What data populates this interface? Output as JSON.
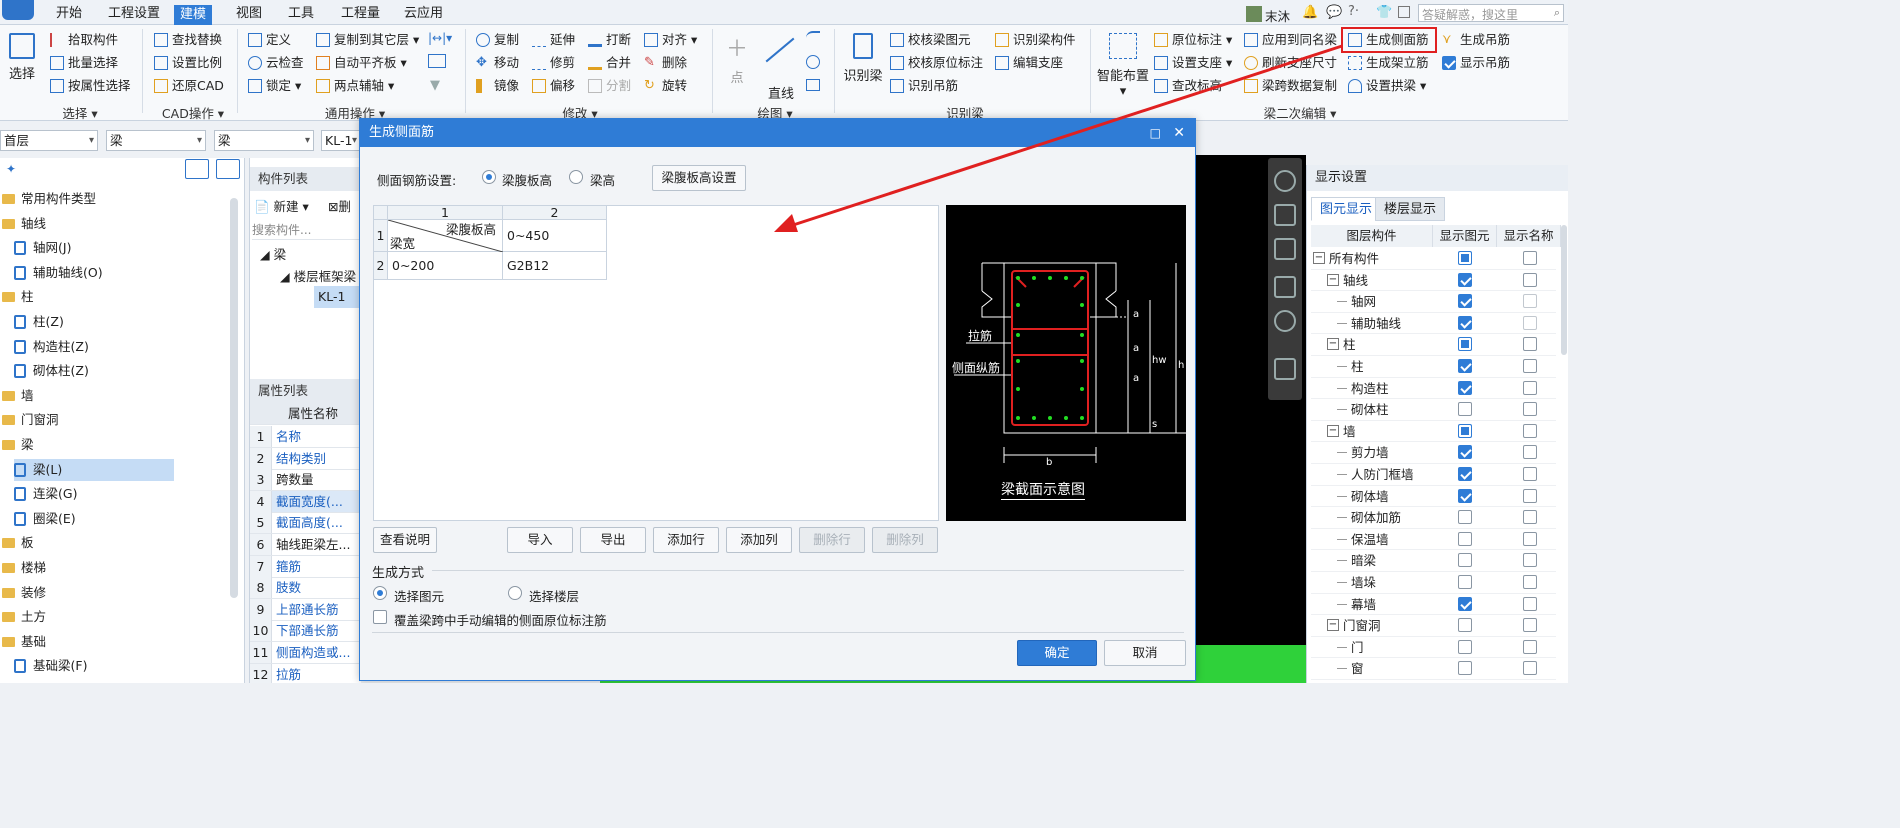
{
  "menubar": {
    "items": [
      "开始",
      "工程设置",
      "建模",
      "视图",
      "工具",
      "工程量",
      "云应用"
    ],
    "active": "建模",
    "user": "末沐",
    "search_placeholder": "答疑解惑，搜这里"
  },
  "ribbon": {
    "select_group": {
      "big": "选择",
      "items": [
        "拾取构件",
        "批量选择",
        "按属性选择"
      ],
      "label": "选择"
    },
    "cad_group": {
      "items": [
        "查找替换",
        "设置比例",
        "还原CAD"
      ],
      "label": "CAD操作"
    },
    "common_group": {
      "items": [
        "定义",
        "云检查",
        "锁定",
        "复制到其它层",
        "自动平齐板",
        "两点辅轴"
      ],
      "label": "通用操作"
    },
    "modify_group": {
      "items": [
        "复制",
        "移动",
        "镜像",
        "延伸",
        "修剪",
        "偏移",
        "打断",
        "合并",
        "分割",
        "对齐",
        "删除",
        "旋转"
      ],
      "label": "修改"
    },
    "draw_group": {
      "items": [
        "点",
        "直线"
      ],
      "label": "绘图"
    },
    "recognize_group": {
      "big": "识别梁",
      "items": [
        "校核梁图元",
        "校核原位标注",
        "识别吊筋",
        "识别梁构件",
        "编辑支座"
      ],
      "label": "识别梁"
    },
    "beam_edit_group": {
      "big": "智能布置",
      "items": [
        "原位标注",
        "设置支座",
        "查改标高",
        "应用到同名梁",
        "刷新支座尺寸",
        "梁跨数据复制",
        "生成侧面筋",
        "生成架立筋",
        "设置拱梁",
        "生成吊筋",
        "显示吊筋"
      ],
      "label": "梁二次编辑"
    }
  },
  "selectors": [
    "首层",
    "梁",
    "梁",
    "KL-1"
  ],
  "left_tree": {
    "items": [
      {
        "label": "常用构件类型",
        "type": "folder"
      },
      {
        "label": "轴线",
        "type": "folder"
      },
      {
        "label": "轴网(J)",
        "type": "leaf"
      },
      {
        "label": "辅助轴线(O)",
        "type": "leaf"
      },
      {
        "label": "柱",
        "type": "folder"
      },
      {
        "label": "柱(Z)",
        "type": "leaf"
      },
      {
        "label": "构造柱(Z)",
        "type": "leaf"
      },
      {
        "label": "砌体柱(Z)",
        "type": "leaf"
      },
      {
        "label": "墙",
        "type": "folder"
      },
      {
        "label": "门窗洞",
        "type": "folder"
      },
      {
        "label": "梁",
        "type": "folder"
      },
      {
        "label": "梁(L)",
        "type": "leaf",
        "selected": true
      },
      {
        "label": "连梁(G)",
        "type": "leaf"
      },
      {
        "label": "圈梁(E)",
        "type": "leaf"
      },
      {
        "label": "板",
        "type": "folder"
      },
      {
        "label": "楼梯",
        "type": "folder"
      },
      {
        "label": "装修",
        "type": "folder"
      },
      {
        "label": "土方",
        "type": "folder"
      },
      {
        "label": "基础",
        "type": "folder"
      },
      {
        "label": "基础梁(F)",
        "type": "leaf"
      }
    ]
  },
  "component_list": {
    "title": "构件列表",
    "new_button": "新建",
    "delete_button": "删",
    "search_placeholder": "搜索构件...",
    "tree": [
      "梁",
      "楼层框架梁",
      "KL-1"
    ]
  },
  "property_list": {
    "title": "属性列表",
    "col_header": "属性名称",
    "rows": [
      {
        "n": "1",
        "name": "名称",
        "blue": true
      },
      {
        "n": "2",
        "name": "结构类别",
        "blue": true
      },
      {
        "n": "3",
        "name": "跨数量",
        "blue": false
      },
      {
        "n": "4",
        "name": "截面宽度(...",
        "blue": true
      },
      {
        "n": "5",
        "name": "截面高度(...",
        "blue": true
      },
      {
        "n": "6",
        "name": "轴线距梁左...",
        "blue": false
      },
      {
        "n": "7",
        "name": "箍筋",
        "blue": true
      },
      {
        "n": "8",
        "name": "肢数",
        "blue": true
      },
      {
        "n": "9",
        "name": "上部通长筋",
        "blue": true
      },
      {
        "n": "10",
        "name": "下部通长筋",
        "blue": true
      },
      {
        "n": "11",
        "name": "侧面构造或...",
        "blue": true
      },
      {
        "n": "12",
        "name": "拉筋",
        "blue": true
      }
    ]
  },
  "dialog": {
    "title": "生成侧面筋",
    "setting_label": "侧面钢筋设置:",
    "radio_options": [
      "梁腹板高",
      "梁高"
    ],
    "radio_selected": "梁腹板高",
    "web_height_button": "梁腹板高设置",
    "table": {
      "col_headers": [
        "1",
        "2"
      ],
      "row_headers": [
        "1",
        "2"
      ],
      "corner_top": "梁腹板高",
      "corner_bottom": "梁宽",
      "r1c2": "0~450",
      "r2c1": "0~200",
      "r2c2": "G2B12"
    },
    "preview": {
      "caption": "梁截面示意图",
      "label_tie": "拉筋",
      "label_side": "侧面纵筋",
      "dim_a": "a",
      "dim_hw": "hw",
      "dim_h": "h",
      "dim_s": "s",
      "dim_b": "b"
    },
    "buttons": {
      "help": "查看说明",
      "import": "导入",
      "export": "导出",
      "add_row": "添加行",
      "add_col": "添加列",
      "del_row": "删除行",
      "del_col": "删除列"
    },
    "gen_mode_label": "生成方式",
    "gen_options": [
      "选择图元",
      "选择楼层"
    ],
    "gen_selected": "选择图元",
    "override_label": "覆盖梁跨中手动编辑的侧面原位标注筋",
    "override_checked": false,
    "ok": "确定",
    "cancel": "取消"
  },
  "display_settings": {
    "title": "显示设置",
    "tabs": [
      "图元显示",
      "楼层显示"
    ],
    "active_tab": "图元显示",
    "columns": [
      "图层构件",
      "显示图元",
      "显示名称"
    ],
    "rows": [
      {
        "label": "所有构件",
        "level": 0,
        "exp": "−",
        "show": "part",
        "name": false
      },
      {
        "label": "轴线",
        "level": 1,
        "exp": "−",
        "show": "on",
        "name": false
      },
      {
        "label": "轴网",
        "level": 2,
        "show": "on",
        "name": "dis"
      },
      {
        "label": "辅助轴线",
        "level": 2,
        "show": "on",
        "name": "dis"
      },
      {
        "label": "柱",
        "level": 1,
        "exp": "−",
        "show": "part",
        "name": false
      },
      {
        "label": "柱",
        "level": 2,
        "show": "on",
        "name": false
      },
      {
        "label": "构造柱",
        "level": 2,
        "show": "on",
        "name": false
      },
      {
        "label": "砌体柱",
        "level": 2,
        "show": false,
        "name": false
      },
      {
        "label": "墙",
        "level": 1,
        "exp": "−",
        "show": "part",
        "name": false
      },
      {
        "label": "剪力墙",
        "level": 2,
        "show": "on",
        "name": false
      },
      {
        "label": "人防门框墙",
        "level": 2,
        "show": "on",
        "name": false
      },
      {
        "label": "砌体墙",
        "level": 2,
        "show": "on",
        "name": false
      },
      {
        "label": "砌体加筋",
        "level": 2,
        "show": false,
        "name": false
      },
      {
        "label": "保温墙",
        "level": 2,
        "show": false,
        "name": false
      },
      {
        "label": "暗梁",
        "level": 2,
        "show": false,
        "name": false
      },
      {
        "label": "墙垛",
        "level": 2,
        "show": false,
        "name": false
      },
      {
        "label": "幕墙",
        "level": 2,
        "show": "on",
        "name": false
      },
      {
        "label": "门窗洞",
        "level": 1,
        "exp": "−",
        "show": false,
        "name": false
      },
      {
        "label": "门",
        "level": 2,
        "show": false,
        "name": false
      },
      {
        "label": "窗",
        "level": 2,
        "show": false,
        "name": false
      }
    ]
  },
  "colors": {
    "accent": "#2f7cd6",
    "highlight": "#e02020",
    "canvas_bg": "#000000",
    "floor_green": "#2fd13a",
    "rebar_red": "#e02020",
    "rebar_dot": "#22dd22"
  }
}
